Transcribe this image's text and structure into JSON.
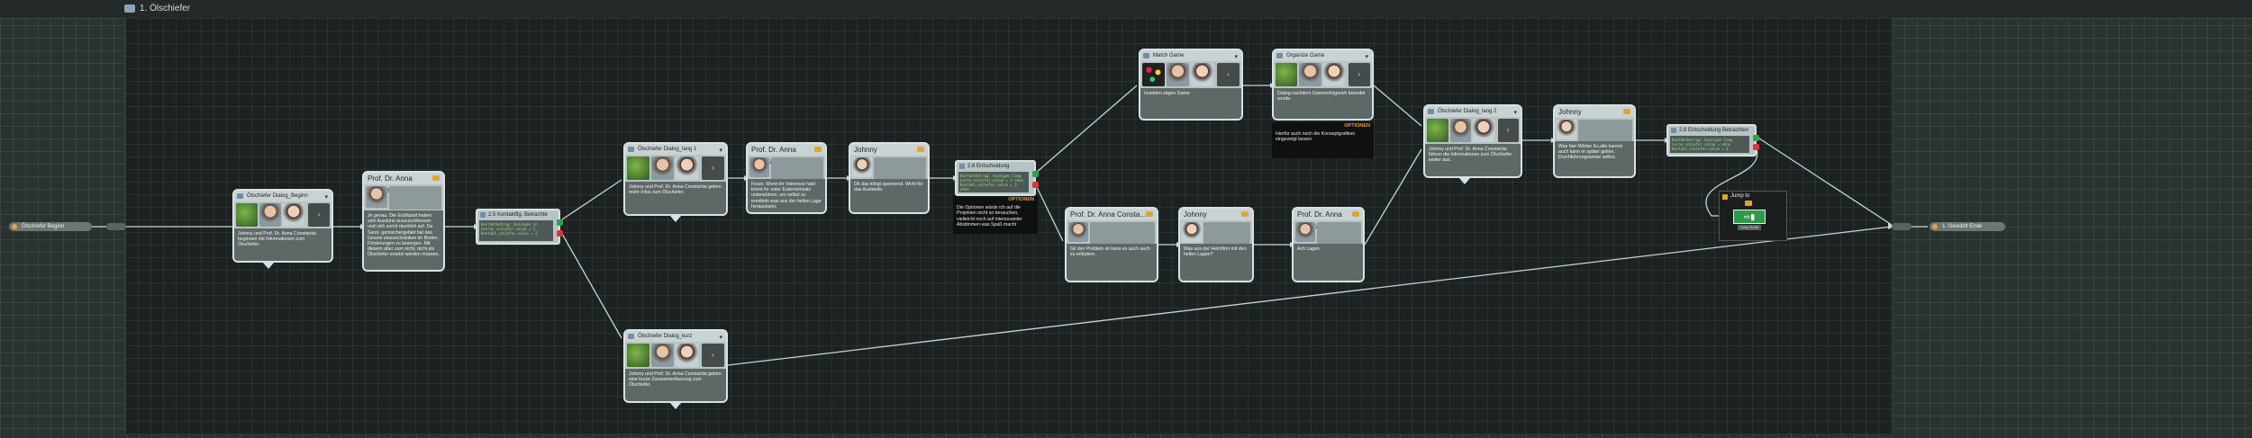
{
  "breadcrumb": {
    "title": "1. Ölschiefer"
  },
  "pins": {
    "start": "Ölschiefer Beginn",
    "end": "1. Gewählt Ende"
  },
  "nodes": {
    "n1": {
      "header": "Ölschiefer Dialog_Beginn",
      "text": "Johnny und Prof. Dr. Anna Constantia beginnen mit Informationen zum Ölschiefer."
    },
    "n2": {
      "header": "Prof. Dr. Anna Consta...",
      "text": "Je genau. Die Erdölpost hatten sich Ausdünn auszuschliessen und sich somit räumlich auf. Da Sand- gemischergebiet hat das Gesetz einzuschränken im Boden. Förderungen zu besorgen. Mit diesem aber zum nicht, nicht als Ölschiefer ersetzt werden müssen."
    },
    "n3": {
      "header": "2.5 Kontaktfig. Betrachte Ende",
      "code": "Kontaktbetrag: Anzeigen in Leeren_schiefer.value = 2\nKontakt_schiefer.value = 2"
    },
    "n4": {
      "header": "Ölschiefer Dialog_lang 1",
      "text": "Johnny und Prof. Dr. Anna Constantia geben mehr Infos zum Ölschiefer."
    },
    "n5": {
      "header": "Prof. Dr. Anna Consta...",
      "text": "Feuer. Wenn ihr Interesse habt könnt ihr unter Externeinsatz unterstützen, um selbst zu ermitteln was aus der hellen Lage herauskann."
    },
    "n6": {
      "header": "Johnny",
      "text": "Ok das klingt spannend. Wohl für das Auslande."
    },
    "n7": {
      "header": "2.6 Entscheidung Betrachten lang",
      "code": "Kontaktbetrag: Anzeigen lang\nLerne_schiefer.value = 3 ohne\nKontakt_schiefer.value = 3 ohne"
    },
    "n8": {
      "header": "Ölschiefer Dialog_kurz",
      "text": "Johnny und Prof. Dr. Anna Constantia geben eine kurze Zusammenfassung zum Ölschiefer."
    },
    "n9": {
      "header": "Match Game",
      "text": "Insekten sägen Game"
    },
    "n10": {
      "header": "Organize Game",
      "text": "Dialog nachdem Gameerfolgreich beendet wurde."
    },
    "n11": {
      "header": "Prof. Dr. Anna Consta...",
      "text": "Gil den Problem ist kann es auch auch zu erläutern."
    },
    "n12": {
      "header": "Johnny",
      "text": "Was aus der Heimfirm mit den hellen Lagen?"
    },
    "n13": {
      "header": "Prof. Dr. Anna Consta...",
      "text": "Ach Lagen."
    },
    "n14": {
      "header": "Ölschiefer Dialog_lang 2",
      "text": "Johnny und Prof. Dr. Anna Constantia führen die Informationen zum Ölschiefer weiter aus."
    },
    "n15": {
      "header": "Johnny",
      "text": "Was hier Wörter Ex,alle kannst auch kann er später gelten. Durchfuhrungsweise selbst."
    },
    "n16": {
      "header": "2.8 Entscheidung Betrachten lang",
      "code": "Kontaktbetrag: Anzeigen lang\nLerne_schiefer.value = ohne\nKontakt_schiefer.value = 4"
    }
  },
  "notes": {
    "note1": {
      "tag": "OPTIONEN",
      "text": "Die Optionen würde ich auf die Projekten nicht so berauchen, vielleicht noch auf interessanter Abstimmen was Spaß macht"
    },
    "note2": {
      "tag": "OPTIONEN",
      "text": "Hierfür auch noch die Konzeptgrafiken eingezeigt lassen."
    }
  },
  "jump": {
    "header": "Jump to",
    "label": "Jump Ende"
  },
  "colors": {
    "accent": "#e2a431",
    "link": "#c9d3d4",
    "background": "#1c2221"
  }
}
